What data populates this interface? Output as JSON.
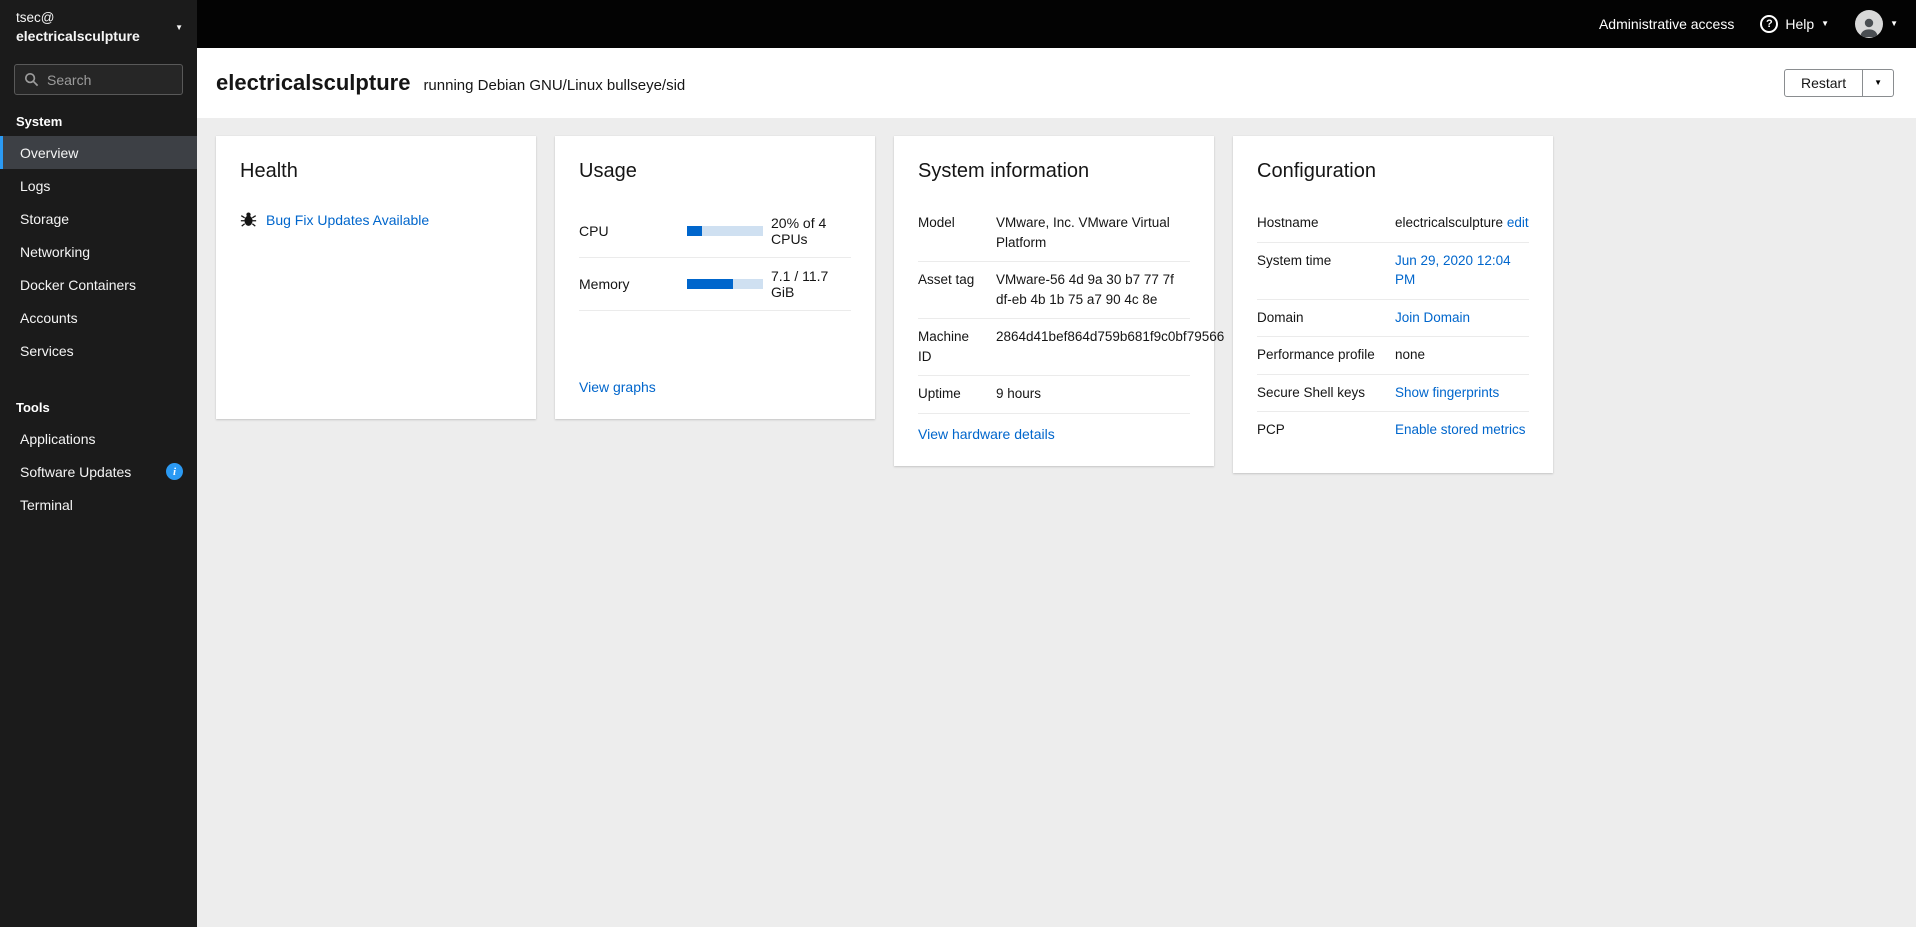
{
  "masthead": {
    "admin_access_label": "Administrative access",
    "help_label": "Help"
  },
  "sidebar": {
    "user_prefix": "tsec@",
    "hostname": "electricalsculpture",
    "search_placeholder": "Search",
    "system_section_label": "System",
    "tools_section_label": "Tools",
    "system_items": [
      {
        "label": "Overview"
      },
      {
        "label": "Logs"
      },
      {
        "label": "Storage"
      },
      {
        "label": "Networking"
      },
      {
        "label": "Docker Containers"
      },
      {
        "label": "Accounts"
      },
      {
        "label": "Services"
      }
    ],
    "tools_items": [
      {
        "label": "Applications"
      },
      {
        "label": "Software Updates",
        "badge": "i"
      },
      {
        "label": "Terminal"
      }
    ]
  },
  "header": {
    "hostname": "electricalsculpture",
    "subtitle": "running Debian GNU/Linux bullseye/sid",
    "restart_label": "Restart"
  },
  "cards": {
    "health": {
      "title": "Health",
      "update_link": "Bug Fix Updates Available"
    },
    "usage": {
      "title": "Usage",
      "cpu_label": "CPU",
      "cpu_value": "20% of 4 CPUs",
      "cpu_percent": 20,
      "memory_label": "Memory",
      "memory_value": "7.1 / 11.7 GiB",
      "memory_percent": 61,
      "view_graphs_link": "View graphs"
    },
    "system_info": {
      "title": "System information",
      "rows": [
        {
          "label": "Model",
          "value": "VMware, Inc. VMware Virtual Platform"
        },
        {
          "label": "Asset tag",
          "value": "VMware-56 4d 9a 30 b7 77 7f df-eb 4b 1b 75 a7 90 4c 8e"
        },
        {
          "label": "Machine ID",
          "value": "2864d41bef864d759b681f9c0bf79566"
        },
        {
          "label": "Uptime",
          "value": "9 hours"
        }
      ],
      "hardware_link": "View hardware details"
    },
    "configuration": {
      "title": "Configuration",
      "hostname_label": "Hostname",
      "hostname_value": "electricalsculpture",
      "hostname_edit_link": "edit",
      "system_time_label": "System time",
      "system_time_value": "Jun 29, 2020 12:04 PM",
      "domain_label": "Domain",
      "domain_value": "Join Domain",
      "performance_label": "Performance profile",
      "performance_value": "none",
      "ssh_label": "Secure Shell keys",
      "ssh_value": "Show fingerprints",
      "pcp_label": "PCP",
      "pcp_value": "Enable stored metrics"
    }
  },
  "colors": {
    "link_blue": "#0066cc",
    "progress_blue": "#0066cc",
    "badge_blue": "#2b9af3",
    "sidebar_dark": "#1b1b1b",
    "masthead_black": "#030303"
  }
}
